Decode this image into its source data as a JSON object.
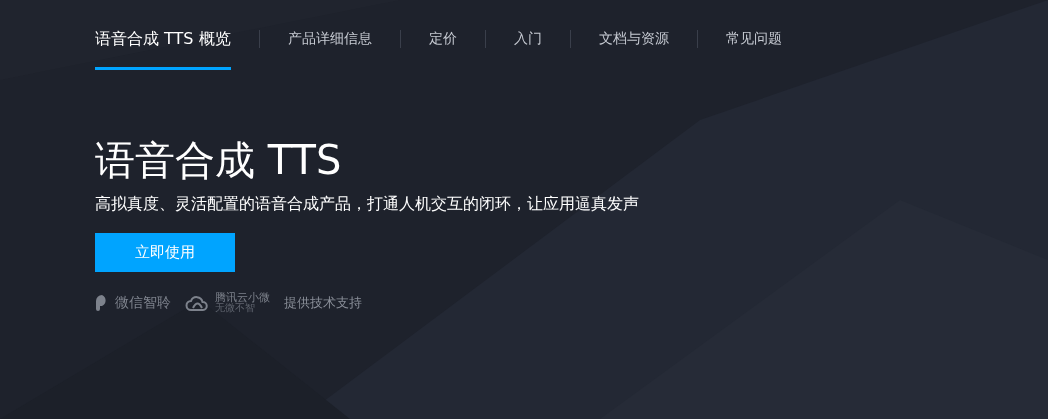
{
  "nav": [
    {
      "label": "语音合成 TTS 概览",
      "selected": true
    },
    {
      "label": "产品详细信息",
      "selected": false
    },
    {
      "label": "定价",
      "selected": false
    },
    {
      "label": "入门",
      "selected": false
    },
    {
      "label": "文档与资源",
      "selected": false
    },
    {
      "label": "常见问题",
      "selected": false
    }
  ],
  "hero": {
    "title": "语音合成 TTS",
    "subtitle": "高拟真度、灵活配置的语音合成产品，打通人机交互的闭环，让应用逼真发声",
    "button": "立即使用"
  },
  "partners": [
    {
      "kind": "wechat",
      "name": "微信智聆"
    },
    {
      "kind": "cloud",
      "name": "腾讯云小微",
      "tagline": "无微不智"
    }
  ],
  "support_text": "提供技术支持"
}
